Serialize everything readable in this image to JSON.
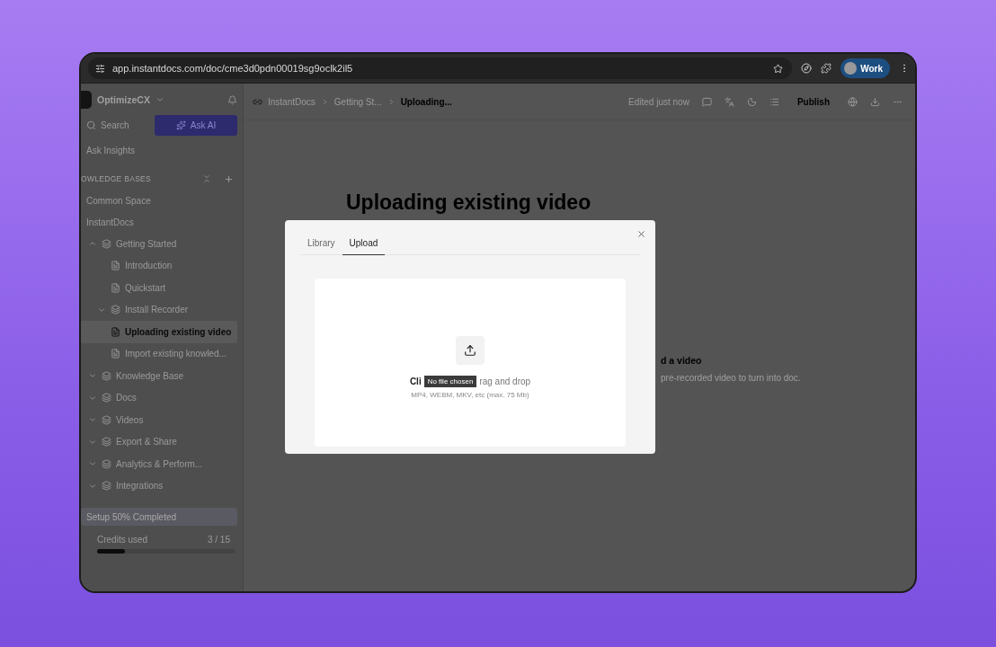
{
  "browser": {
    "url": "app.instantdocs.com/doc/cme3d0pdn00019sg9oclk2il5",
    "profile": "Work"
  },
  "sidebar": {
    "workspace": "OptimizeCX",
    "search": "Search",
    "ask_ai": "Ask AI",
    "ask_insights": "Ask Insights",
    "section": "OWLEDGE BASES",
    "spaces": [
      "Common Space",
      "InstantDocs"
    ],
    "tree": [
      {
        "label": "Getting Started",
        "kind": "folder",
        "expanded": true,
        "selected": false,
        "children": [
          {
            "label": "Introduction",
            "kind": "page",
            "selected": false
          },
          {
            "label": "Quickstart",
            "kind": "page",
            "selected": false
          },
          {
            "label": "Install Recorder",
            "kind": "recorder",
            "expanded": false,
            "selected": false
          },
          {
            "label": "Uploading existing video",
            "kind": "page",
            "selected": true
          },
          {
            "label": "Import existing knowled...",
            "kind": "page",
            "selected": false
          }
        ]
      },
      {
        "label": "Knowledge Base",
        "kind": "folder",
        "expanded": false,
        "selected": false
      },
      {
        "label": "Docs",
        "kind": "folder",
        "expanded": false,
        "selected": false
      },
      {
        "label": "Videos",
        "kind": "folder",
        "expanded": false,
        "selected": false
      },
      {
        "label": "Export & Share",
        "kind": "folder",
        "expanded": false,
        "selected": false
      },
      {
        "label": "Analytics & Perform...",
        "kind": "folder",
        "expanded": false,
        "selected": false
      },
      {
        "label": "Integrations",
        "kind": "folder",
        "expanded": false,
        "selected": false
      }
    ],
    "setup": "Setup 50% Completed",
    "credits": {
      "label": "Credits used",
      "reading": "3 / 15",
      "level": 0.2
    }
  },
  "topbar": {
    "breadcrumbs": [
      "InstantDocs",
      "Getting St...",
      "Uploading..."
    ],
    "status": "Edited just now",
    "publish": "Publish"
  },
  "document": {
    "title": "Uploading existing video",
    "card": {
      "title": "d a video",
      "description": "pre-recorded video to turn into doc."
    }
  },
  "modal": {
    "tabs": [
      {
        "label": "Library",
        "selected": false
      },
      {
        "label": "Upload",
        "selected": true
      }
    ],
    "dropzone": {
      "prompt_start": "Cli",
      "tooltip": "No file chosen",
      "prompt_end": "rag and drop",
      "hint": "MP4, WEBM, MKV, etc (max. 75 Mb)"
    }
  }
}
